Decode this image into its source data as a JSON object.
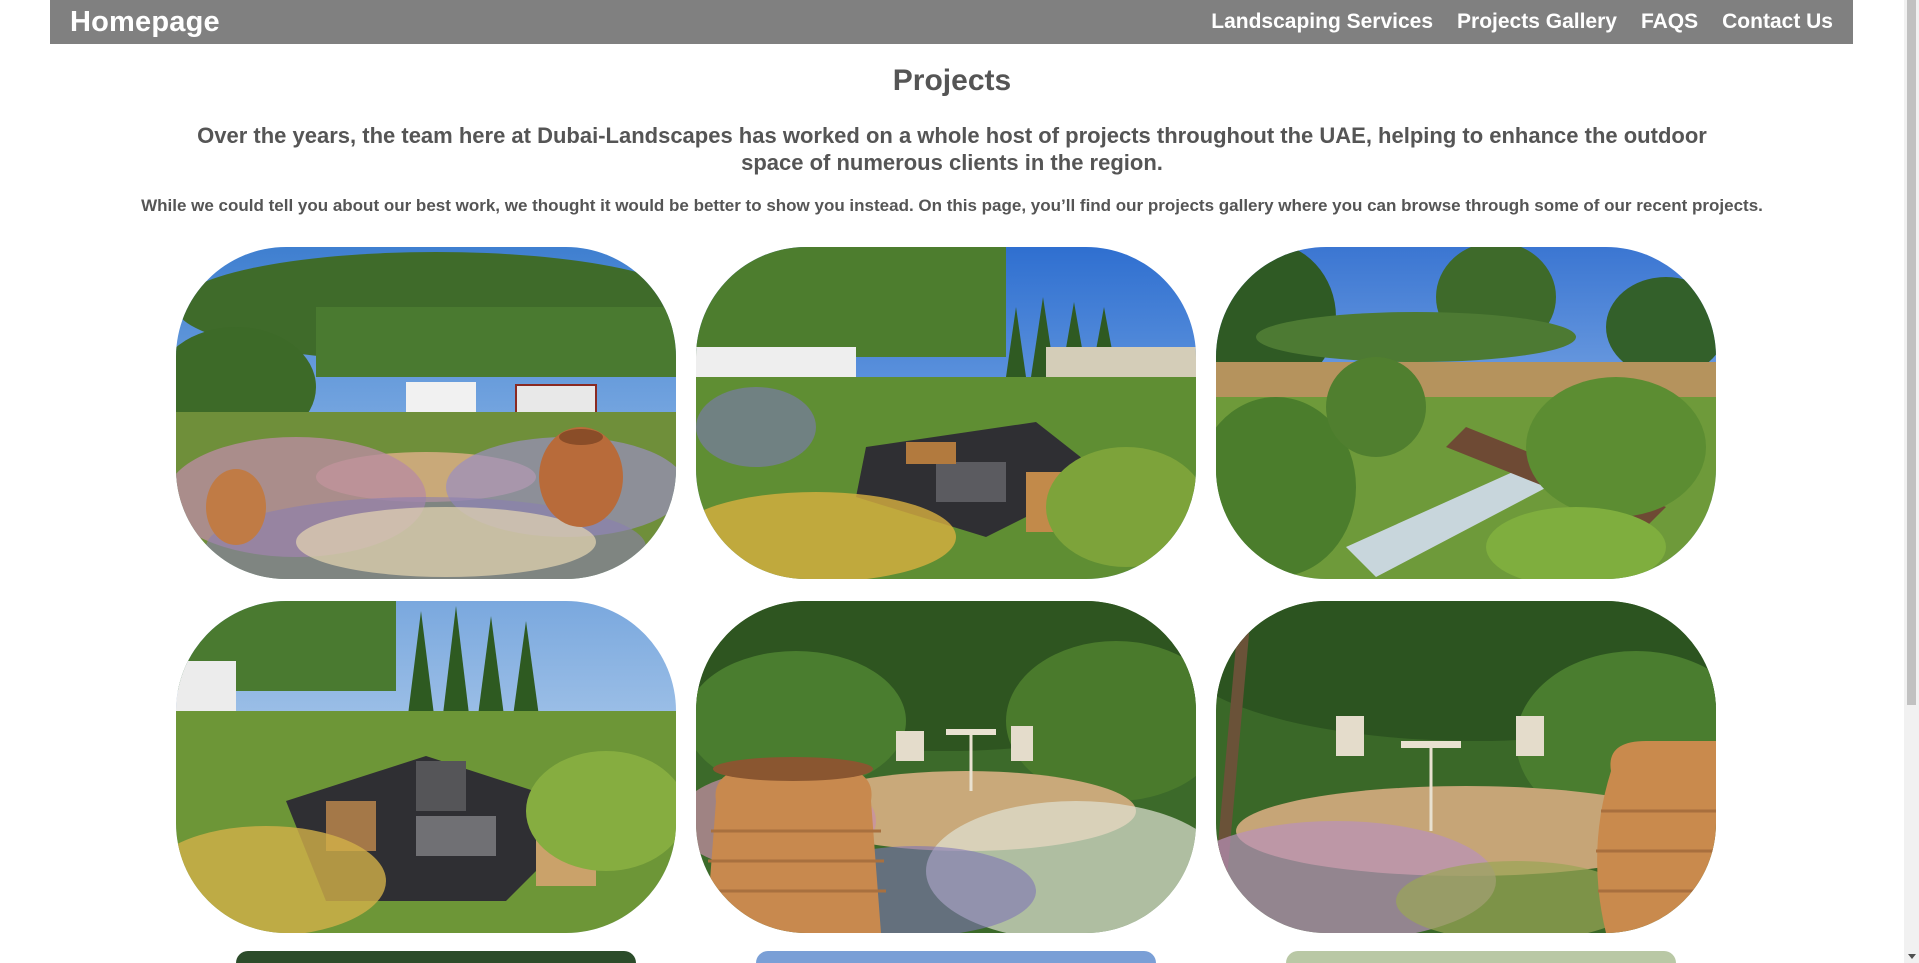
{
  "nav": {
    "brand": "Homepage",
    "links": [
      "Landscaping Services",
      "Projects Gallery",
      "FAQS",
      "Contact Us"
    ]
  },
  "main": {
    "title": "Projects",
    "intro": "Over the years, the team here at Dubai-Landscapes has worked on a whole host of projects throughout the UAE, helping to enhance the outdoor space of numerous clients in the region.",
    "subintro": "While we could tell you about our best work, we thought it would be better to show you instead. On this page, you’ll find our projects gallery where you can browse through some of our recent projects."
  },
  "gallery": {
    "photos": [
      {
        "subject": "garden-with-urn-and-pleached-trees"
      },
      {
        "subject": "sunken-seating-area-with-fire-pit"
      },
      {
        "subject": "garden-with-rill-and-timber-path"
      },
      {
        "subject": "sunken-seating-with-benches"
      },
      {
        "subject": "bistro-table-with-urn-fountain"
      },
      {
        "subject": "bistro-chairs-with-terracotta-urn"
      }
    ]
  },
  "colors": {
    "navbar": "#808080",
    "heading_text": "#555555",
    "nav_text": "#ffffff"
  }
}
